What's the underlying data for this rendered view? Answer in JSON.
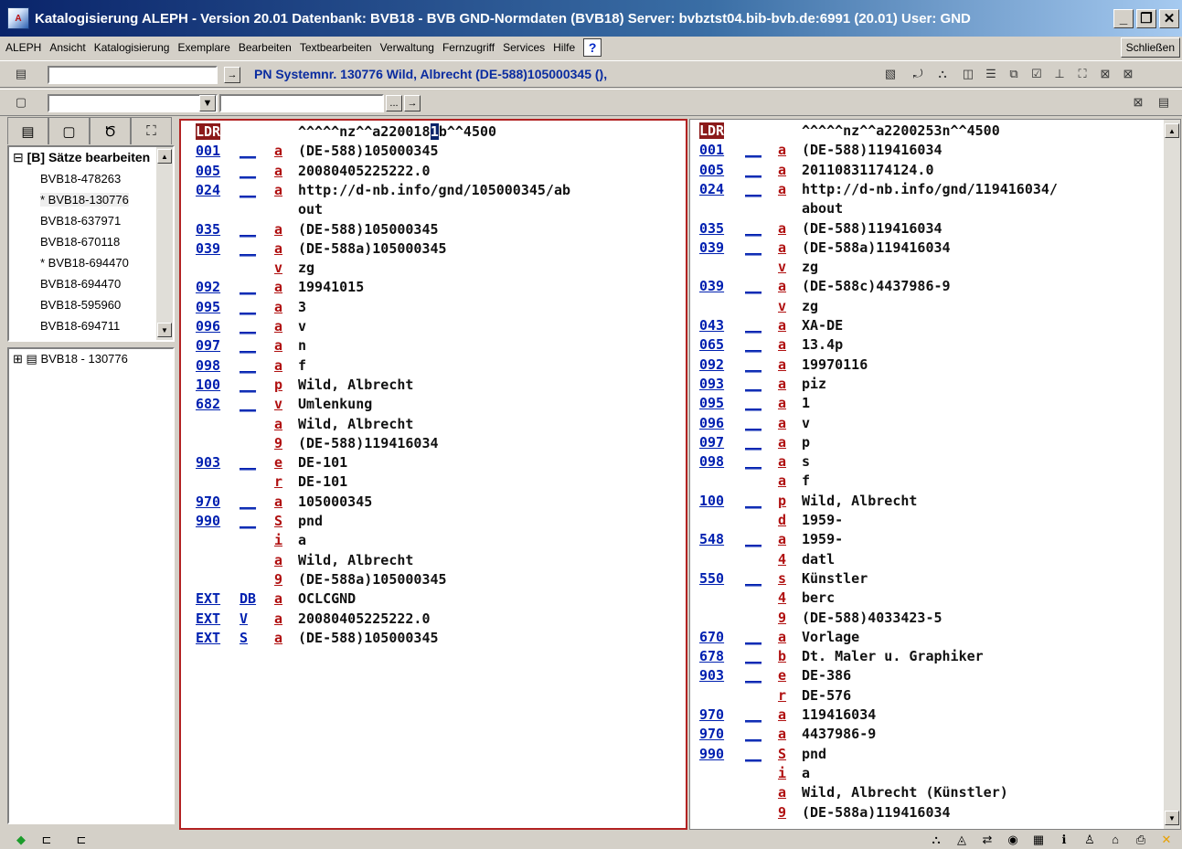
{
  "window": {
    "title": "Katalogisierung ALEPH - Version 20.01  Datenbank:  BVB18 - BVB GND-Normdaten (BVB18)  Server: bvbztst04.bib-bvb.de:6991 (20.01)  User:  GND"
  },
  "menu": {
    "items": [
      "ALEPH",
      "Ansicht",
      "Katalogisierung",
      "Exemplare",
      "Bearbeiten",
      "Textbearbeiten",
      "Verwaltung",
      "Fernzugriff",
      "Services",
      "Hilfe"
    ],
    "help_glyph": "?",
    "close_label": "Schließen"
  },
  "toolbar": {
    "record_title": "PN Systemnr. 130776 Wild, Albrecht (DE-588)105000345 (),",
    "field_value_1": "",
    "field_value_2": "",
    "field_value_3": "",
    "dropdown_glyph": "▼",
    "ellipsis_glyph": "...",
    "arrow_glyph": "→"
  },
  "tree": {
    "root_label": "[B] Sätze bearbeiten",
    "items": [
      "BVB18-478263",
      "* BVB18-130776",
      "BVB18-637971",
      "BVB18-670118",
      "* BVB18-694470",
      "BVB18-694470",
      "BVB18-595960",
      "BVB18-694711"
    ],
    "bottom_item": "BVB18 - 130776"
  },
  "left_record": [
    {
      "tag": "LDR",
      "ind": "",
      "code": "",
      "text": "^^^^^nz^^a220018",
      "cursor": "1",
      "after": "b^^4500"
    },
    {
      "tag": "001",
      "ind": "__",
      "code": "a",
      "text": "(DE-588)105000345"
    },
    {
      "tag": "005",
      "ind": "__",
      "code": "a",
      "text": "20080405225222.0"
    },
    {
      "tag": "024",
      "ind": "__",
      "code": "a",
      "text": "http://d-nb.info/gnd/105000345/ab"
    },
    {
      "tag": "",
      "ind": "",
      "code": "",
      "text": "out"
    },
    {
      "tag": "035",
      "ind": "__",
      "code": "a",
      "text": "(DE-588)105000345"
    },
    {
      "tag": "039",
      "ind": "__",
      "code": "a",
      "text": "(DE-588a)105000345"
    },
    {
      "tag": "",
      "ind": "",
      "code": "v",
      "text": "zg"
    },
    {
      "tag": "092",
      "ind": "__",
      "code": "a",
      "text": "19941015"
    },
    {
      "tag": "095",
      "ind": "__",
      "code": "a",
      "text": "3"
    },
    {
      "tag": "096",
      "ind": "__",
      "code": "a",
      "text": "v"
    },
    {
      "tag": "097",
      "ind": "__",
      "code": "a",
      "text": "n"
    },
    {
      "tag": "098",
      "ind": "__",
      "code": "a",
      "text": "f"
    },
    {
      "tag": "100",
      "ind": "__",
      "code": "p",
      "text": "Wild, Albrecht"
    },
    {
      "tag": "682",
      "ind": "__",
      "code": "v",
      "text": "Umlenkung"
    },
    {
      "tag": "",
      "ind": "",
      "code": "a",
      "text": "Wild, Albrecht"
    },
    {
      "tag": "",
      "ind": "",
      "code": "9",
      "text": "(DE-588)119416034"
    },
    {
      "tag": "903",
      "ind": "__",
      "code": "e",
      "text": "DE-101"
    },
    {
      "tag": "",
      "ind": "",
      "code": "r",
      "text": "DE-101"
    },
    {
      "tag": "970",
      "ind": "__",
      "code": "a",
      "text": "105000345"
    },
    {
      "tag": "990",
      "ind": "__",
      "code": "S",
      "text": "pnd"
    },
    {
      "tag": "",
      "ind": "",
      "code": "i",
      "text": "a"
    },
    {
      "tag": "",
      "ind": "",
      "code": "a",
      "text": "Wild, Albrecht"
    },
    {
      "tag": "",
      "ind": "",
      "code": "9",
      "text": "(DE-588a)105000345"
    },
    {
      "tag": "EXT",
      "ind": "DB",
      "code": "a",
      "text": "OCLCGND"
    },
    {
      "tag": "EXT",
      "ind": "V",
      "code": "a",
      "text": "20080405225222.0"
    },
    {
      "tag": "EXT",
      "ind": "S",
      "code": "a",
      "text": "(DE-588)105000345"
    }
  ],
  "right_record": [
    {
      "tag": "LDR",
      "ind": "",
      "code": "",
      "text": "^^^^^nz^^a2200253n^^4500"
    },
    {
      "tag": "001",
      "ind": "__",
      "code": "a",
      "text": "(DE-588)119416034"
    },
    {
      "tag": "005",
      "ind": "__",
      "code": "a",
      "text": "20110831174124.0"
    },
    {
      "tag": "024",
      "ind": "__",
      "code": "a",
      "text": "http://d-nb.info/gnd/119416034/"
    },
    {
      "tag": "",
      "ind": "",
      "code": "",
      "text": "about"
    },
    {
      "tag": "035",
      "ind": "__",
      "code": "a",
      "text": "(DE-588)119416034"
    },
    {
      "tag": "039",
      "ind": "__",
      "code": "a",
      "text": "(DE-588a)119416034"
    },
    {
      "tag": "",
      "ind": "",
      "code": "v",
      "text": "zg"
    },
    {
      "tag": "039",
      "ind": "__",
      "code": "a",
      "text": "(DE-588c)4437986-9"
    },
    {
      "tag": "",
      "ind": "",
      "code": "v",
      "text": "zg"
    },
    {
      "tag": "043",
      "ind": "__",
      "code": "a",
      "text": "XA-DE"
    },
    {
      "tag": "065",
      "ind": "__",
      "code": "a",
      "text": "13.4p"
    },
    {
      "tag": "092",
      "ind": "__",
      "code": "a",
      "text": "19970116"
    },
    {
      "tag": "093",
      "ind": "__",
      "code": "a",
      "text": "piz"
    },
    {
      "tag": "095",
      "ind": "__",
      "code": "a",
      "text": "1"
    },
    {
      "tag": "096",
      "ind": "__",
      "code": "a",
      "text": "v"
    },
    {
      "tag": "097",
      "ind": "__",
      "code": "a",
      "text": "p"
    },
    {
      "tag": "098",
      "ind": "__",
      "code": "a",
      "text": "s"
    },
    {
      "tag": "",
      "ind": "",
      "code": "a",
      "text": "f"
    },
    {
      "tag": "100",
      "ind": "__",
      "code": "p",
      "text": "Wild, Albrecht"
    },
    {
      "tag": "",
      "ind": "",
      "code": "d",
      "text": "1959-"
    },
    {
      "tag": "548",
      "ind": "__",
      "code": "a",
      "text": "1959-"
    },
    {
      "tag": "",
      "ind": "",
      "code": "4",
      "text": "datl"
    },
    {
      "tag": "550",
      "ind": "__",
      "code": "s",
      "text": "Künstler"
    },
    {
      "tag": "",
      "ind": "",
      "code": "4",
      "text": "berc"
    },
    {
      "tag": "",
      "ind": "",
      "code": "9",
      "text": "(DE-588)4033423-5"
    },
    {
      "tag": "670",
      "ind": "__",
      "code": "a",
      "text": "Vorlage"
    },
    {
      "tag": "678",
      "ind": "__",
      "code": "b",
      "text": "Dt. Maler u. Graphiker"
    },
    {
      "tag": "903",
      "ind": "__",
      "code": "e",
      "text": "DE-386"
    },
    {
      "tag": "",
      "ind": "",
      "code": "r",
      "text": "DE-576"
    },
    {
      "tag": "970",
      "ind": "__",
      "code": "a",
      "text": "119416034"
    },
    {
      "tag": "970",
      "ind": "__",
      "code": "a",
      "text": "4437986-9"
    },
    {
      "tag": "990",
      "ind": "__",
      "code": "S",
      "text": "pnd"
    },
    {
      "tag": "",
      "ind": "",
      "code": "i",
      "text": "a"
    },
    {
      "tag": "",
      "ind": "",
      "code": "a",
      "text": "Wild, Albrecht (Künstler)"
    },
    {
      "tag": "",
      "ind": "",
      "code": "9",
      "text": "(DE-588a)119416034"
    }
  ],
  "colors": {
    "tag": "#0020b0",
    "code": "#b01010",
    "active_border": "#b22222",
    "ldr_bg": "#8b1a1a"
  }
}
